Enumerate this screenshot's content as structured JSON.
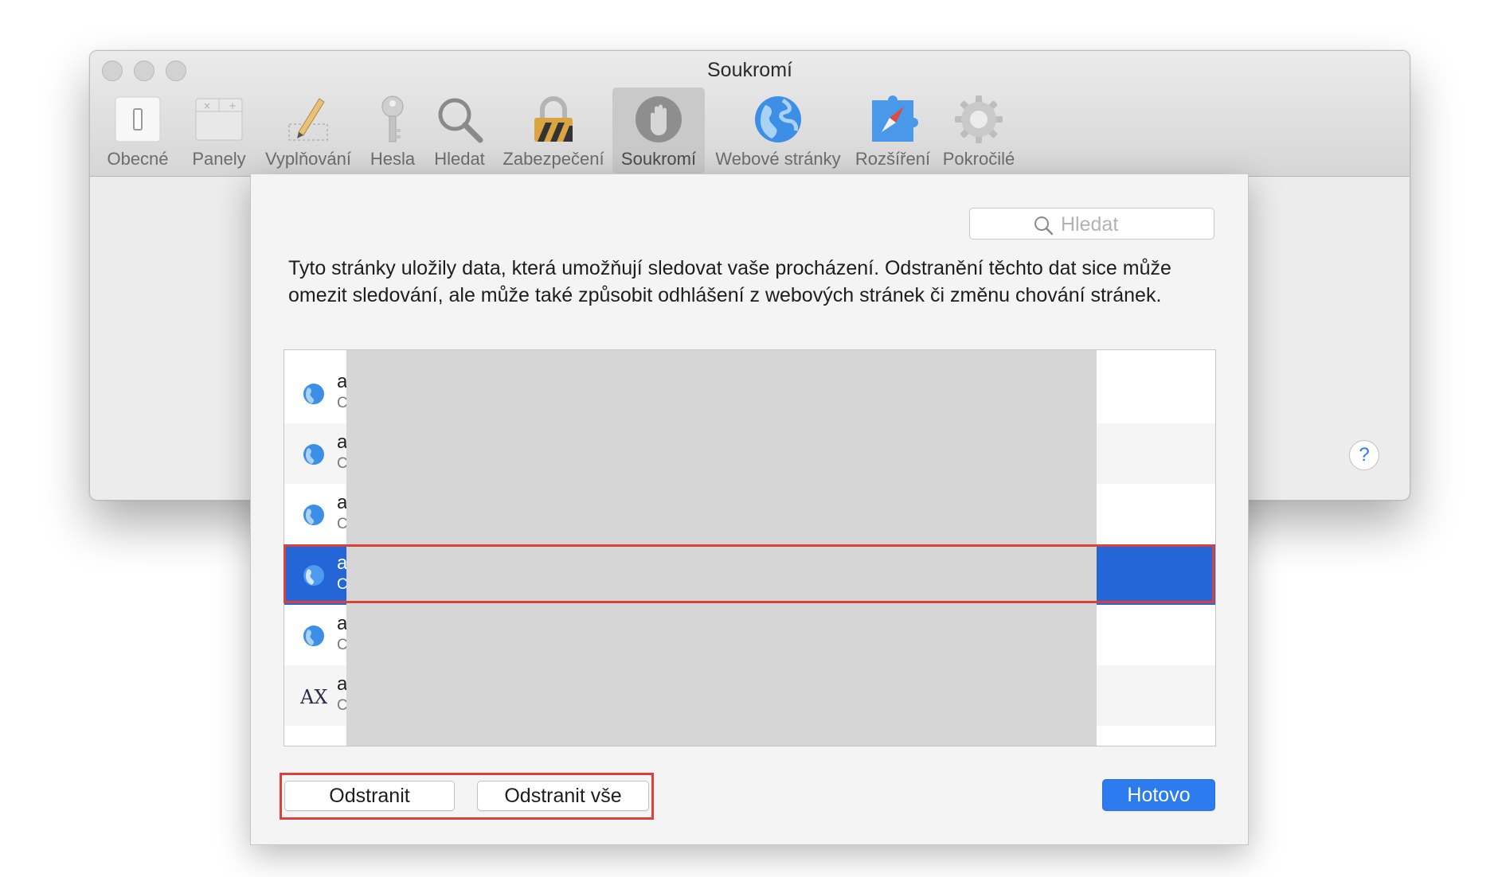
{
  "window": {
    "title": "Soukromí"
  },
  "toolbar": {
    "items": [
      {
        "label": "Obecné",
        "icon": "general-switch-icon"
      },
      {
        "label": "Panely",
        "icon": "tabs-icon"
      },
      {
        "label": "Vyplňování",
        "icon": "pencil-icon"
      },
      {
        "label": "Hesla",
        "icon": "key-icon"
      },
      {
        "label": "Hledat",
        "icon": "search-icon"
      },
      {
        "label": "Zabezpečení",
        "icon": "padlock-icon"
      },
      {
        "label": "Soukromí",
        "icon": "hand-icon",
        "active": true
      },
      {
        "label": "Webové stránky",
        "icon": "globe-icon"
      },
      {
        "label": "Rozšíření",
        "icon": "puzzle-compass-icon"
      },
      {
        "label": "Pokročilé",
        "icon": "gear-icon"
      }
    ]
  },
  "sheet": {
    "search_placeholder": "Hledat",
    "description": "Tyto stránky uložily data, která umožňují sledovat vaše procházení. Odstranění těchto dat sice může omezit sledování, ale může také způsobit odhlášení z webových stránek či změnu chování stránek.",
    "rows": [
      {
        "title": "a",
        "subtitle": "C",
        "icon": "globe-icon"
      },
      {
        "title": "a",
        "subtitle": "C",
        "icon": "globe-icon"
      },
      {
        "title": "a",
        "subtitle": "C",
        "icon": "globe-icon"
      },
      {
        "title": "a",
        "subtitle": "C",
        "icon": "globe-icon",
        "selected": true
      },
      {
        "title": "a",
        "subtitle": "C",
        "icon": "globe-icon"
      },
      {
        "title": "a",
        "subtitle": "C",
        "icon": "ax-logo-icon"
      }
    ],
    "buttons": {
      "remove": "Odstranit",
      "remove_all": "Odstranit vše",
      "done": "Hotovo"
    },
    "help_label": "?"
  },
  "colors": {
    "accent": "#2c7cf0",
    "selection": "#2465d7",
    "highlight": "#d9413a"
  }
}
